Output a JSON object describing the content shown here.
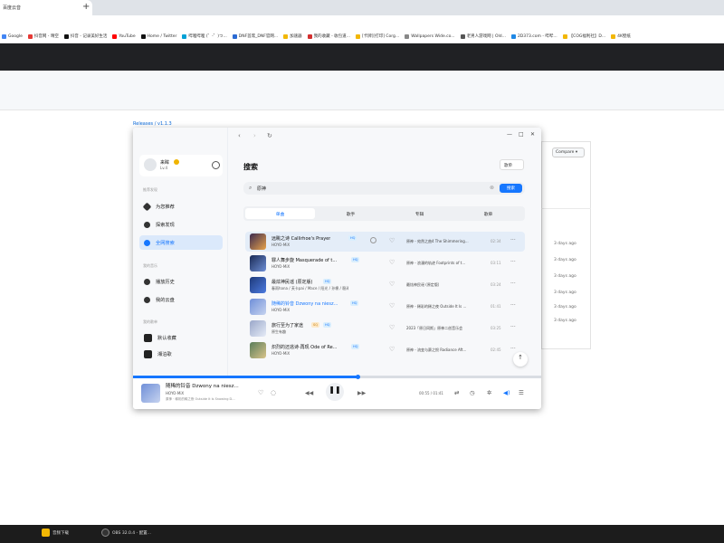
{
  "browser": {
    "tab_title": "百度云音",
    "new_tab": "+",
    "bookmarks": [
      "Google",
      "抖音网 - 晴空",
      "抖音 - 记录美好生活",
      "YouTube",
      "Home / Twitter",
      "哔哩哔哩 (゜-゜)つ...",
      "DNF首席_DNF官网...",
      "加速器",
      "我的收藏 - 收包道...",
      "[卡牌][打印] Corg...",
      "Wallpapers Wide.co...",
      "老男人游戏网 | Old...",
      "2D373.com - 哔哔...",
      "【COG福利社】D...",
      "4K壁纸"
    ]
  },
  "page": {
    "breadcrumb": "Releases / v1.1.3",
    "compare_label": "Compare ▾",
    "ago_items": [
      "3 days ago",
      "3 days ago",
      "3 days ago",
      "3 days ago",
      "3 days ago",
      "3 days ago"
    ]
  },
  "taskbar": {
    "items": [
      "音频下载",
      "OBS 32.0.4 - 配置..."
    ]
  },
  "app": {
    "sidebar": {
      "user_name": "来眸",
      "user_status": "Lv.4",
      "section_recommend": "推荐发现",
      "item_recommend": "为您推荐",
      "item_discover": "探索发现",
      "item_search": "全网搜索",
      "section_mine": "我的音乐",
      "item_history": "播放历史",
      "item_cloud": "我的云盘",
      "section_playlist": "我的歌单",
      "item_default": "默认收藏",
      "item_xiangbo": "湘泊歌"
    },
    "nav": {
      "back": "‹",
      "forward": "›",
      "refresh": "↻"
    },
    "window": {
      "min": "—",
      "max": "□",
      "close": "✕"
    },
    "title": "搜索",
    "comment_btn": "歌单",
    "search": {
      "value": "原神",
      "button": "搜索"
    },
    "tabs": [
      "单曲",
      "歌手",
      "专辑",
      "歌单"
    ],
    "songs": [
      {
        "title": "远眺之诗 Callirhoe's Prayer",
        "artist": "HOYO-MiX",
        "tag": "HQ",
        "tag2": "",
        "album": "原神 - 宛然之曲4 The Shimmering...",
        "duration": "02:34"
      },
      {
        "title": "罪人舞步旋 Masquerade of t...",
        "artist": "HOYO-MiX",
        "tag": "HQ",
        "tag2": "",
        "album": "原神 - 浪漫的轨迹 Footprints of t...",
        "duration": "03:11"
      },
      {
        "title": "最炫神民谣 (原定版)",
        "artist": "春雨hana / 芙卡pai / Mace / 阳光 / 孙棉 / 稳泽",
        "tag": "HQ",
        "tag2": "",
        "album": "最炫神民谣 (原定版)",
        "duration": "03:24"
      },
      {
        "title": "随稀的铃音 Dzwony na niesz...",
        "artist": "HOYO-MiX",
        "tag": "HQ",
        "tag2": "",
        "album": "原神 - 稀彩的稀之夜 Outside It Is ...",
        "duration": "01:41"
      },
      {
        "title": "旅行至为了家途",
        "artist": "原生有趣",
        "tag": "SQ",
        "tag2": "HQ",
        "album": "2023「原日同斯」原神二创音乐会",
        "duration": "03:25"
      },
      {
        "title": "炽烈的还逃诗·再现 Ode of Re...",
        "artist": "HOYO-MiX",
        "tag": "HQ",
        "tag2": "",
        "album": "原神 - 流变与赛之恨 Radiance Aft...",
        "duration": "02:45"
      }
    ],
    "scroll_top": "↑",
    "player": {
      "title": "随稀的铃音 Dzwony na niesz...",
      "artist": "HOYO-MiX",
      "lyric": "原神 · 稀彩的稀之夜 Outside It Is Snowing D...",
      "time": "00:55 / 01:41",
      "progress": 0.55,
      "prev": "◀◀",
      "play": "❚❚",
      "next": "▶▶"
    }
  }
}
